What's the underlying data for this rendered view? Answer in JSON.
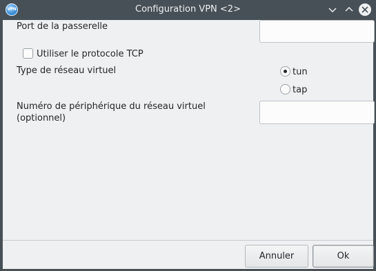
{
  "window": {
    "title": "Configuration VPN <2>",
    "app_icon_text": "VPN"
  },
  "titlebar_buttons": [
    "chevron-down-icon",
    "chevron-up-icon",
    "close-icon"
  ],
  "form": {
    "gateway_port_label": "Port de la passerelle",
    "gateway_port_value": "",
    "use_tcp_label": "Utiliser le protocole TCP",
    "use_tcp_checked": false,
    "network_type_label": "Type de réseau virtuel",
    "network_type_options": [
      {
        "label": "tun",
        "selected": true
      },
      {
        "label": "tap",
        "selected": false
      }
    ],
    "device_number_label_line1": "Numéro de périphérique du réseau virtuel",
    "device_number_label_line2": "(optionnel)",
    "device_number_value": ""
  },
  "buttons": {
    "cancel": "Annuler",
    "ok": "Ok"
  }
}
